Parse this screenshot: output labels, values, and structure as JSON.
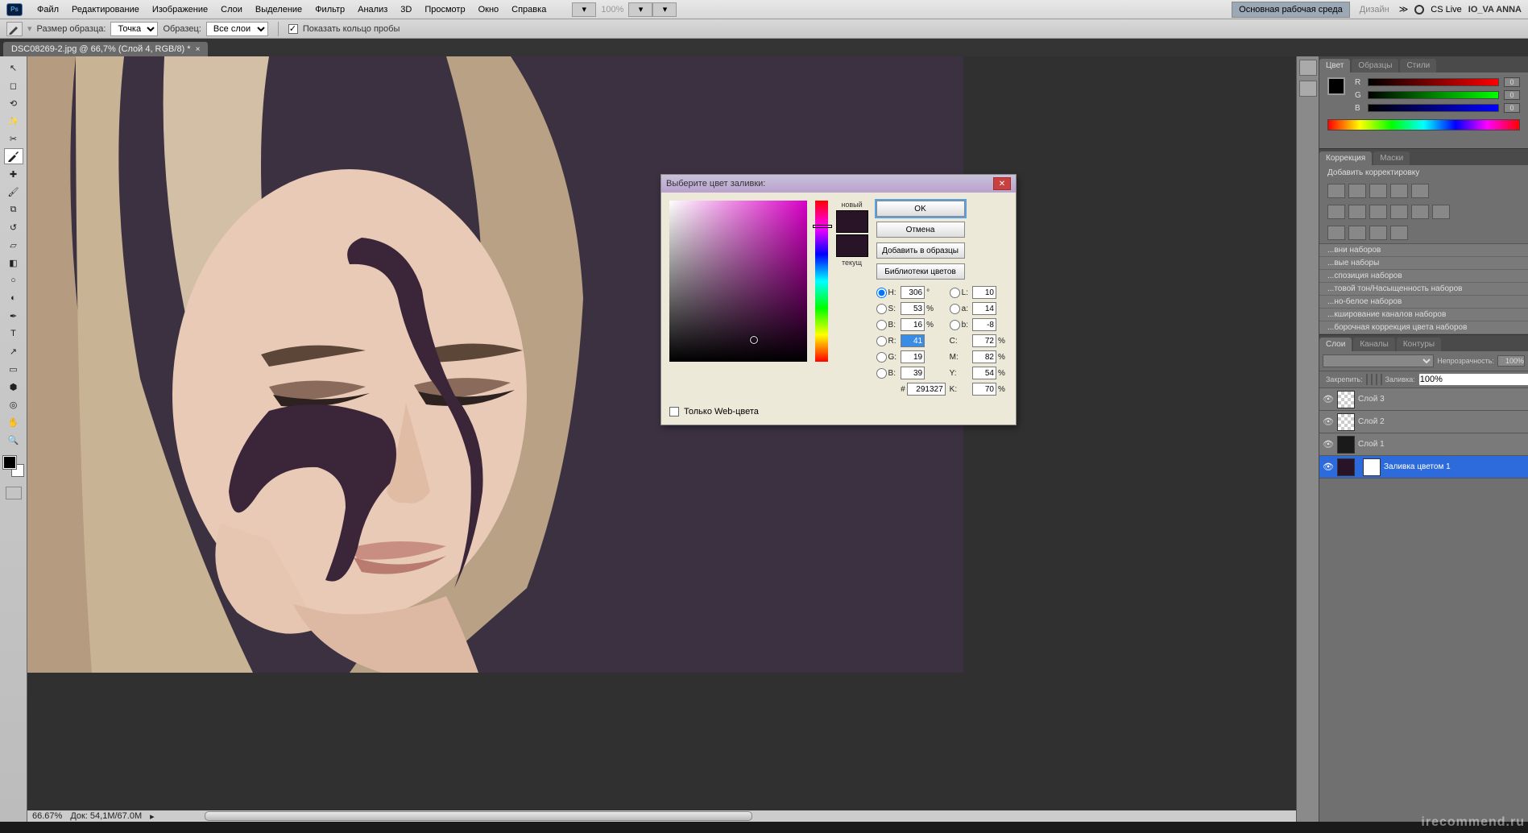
{
  "menu": {
    "items": [
      "Файл",
      "Редактирование",
      "Изображение",
      "Слои",
      "Выделение",
      "Фильтр",
      "Анализ",
      "3D",
      "Просмотр",
      "Окно",
      "Справка"
    ],
    "zoom_percent": "100%",
    "workspace_btn": "Основная рабочая среда",
    "design_label": "Дизайн",
    "cs_live": "CS Live",
    "user_name": "IO_VA ANNA"
  },
  "options": {
    "sample_size_label": "Размер образца:",
    "sample_size_value": "Точка",
    "sample_label": "Образец:",
    "sample_value": "Все слои",
    "show_ring": "Показать кольцо пробы"
  },
  "tab": {
    "filename": "DSC08269-2.jpg @ 66,7% (Слой 4, RGB/8) *"
  },
  "status": {
    "zoom": "66.67%",
    "doc": "Док: 54,1M/67.0M"
  },
  "right": {
    "color_tabs": [
      "Цвет",
      "Образцы",
      "Стили"
    ],
    "rgb": {
      "r": "0",
      "g": "0",
      "b": "0"
    },
    "adj_tabs": [
      "Коррекция",
      "Маски"
    ],
    "adj_title": "Добавить корректировку",
    "adj_presets": [
      "...вни наборов",
      "...вые наборы",
      "...спозиция наборов",
      "...товой тон/Насыщенность наборов",
      "...но-белое наборов",
      "...кширование каналов наборов",
      "...борочная коррекция цвета наборов"
    ],
    "layers_tabs": [
      "Слои",
      "Каналы",
      "Контуры"
    ],
    "opacity_label": "Непрозрачность:",
    "opacity_value": "100%",
    "fill_label": "Заливка:",
    "fill_value": "100%",
    "lock_label": "Закрепить:",
    "layers": [
      {
        "name": "Слой 3"
      },
      {
        "name": "Слой 2"
      },
      {
        "name": "Слой 1"
      },
      {
        "name": "Заливка цветом 1",
        "selected": true
      }
    ]
  },
  "dialog": {
    "title": "Выберите цвет заливки:",
    "new_label": "новый",
    "current_label": "текущ",
    "ok": "OK",
    "cancel": "Отмена",
    "add_swatch": "Добавить в образцы",
    "libraries": "Библиотеки цветов",
    "web_only": "Только Web-цвета",
    "hex": "291327",
    "hsb": {
      "h": "306",
      "s": "53",
      "b": "16"
    },
    "lab": {
      "l": "10",
      "a": "14",
      "b": "-8"
    },
    "rgb": {
      "r": "41",
      "g": "19",
      "b": "39"
    },
    "cmyk": {
      "c": "72",
      "m": "82",
      "y": "54",
      "k": "70"
    }
  },
  "watermark": "irecommend.ru"
}
